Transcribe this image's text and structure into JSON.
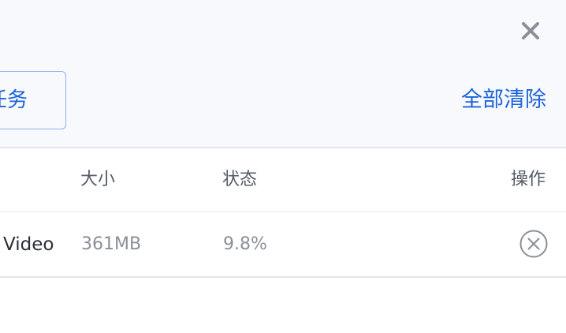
{
  "toolbar": {
    "task_button_label": "任务",
    "clear_all_label": "全部清除",
    "close_icon": "close-icon"
  },
  "table": {
    "columns": [
      "大小",
      "状态",
      "操作"
    ],
    "rows": [
      {
        "name": "Video",
        "size": "361MB",
        "status": "9.8%",
        "action_icon": "cancel-circle-icon"
      }
    ]
  },
  "colors": {
    "accent": "#1d64d8",
    "header_bg": "#f7f9fc",
    "icon_gray": "#8a8f98"
  }
}
